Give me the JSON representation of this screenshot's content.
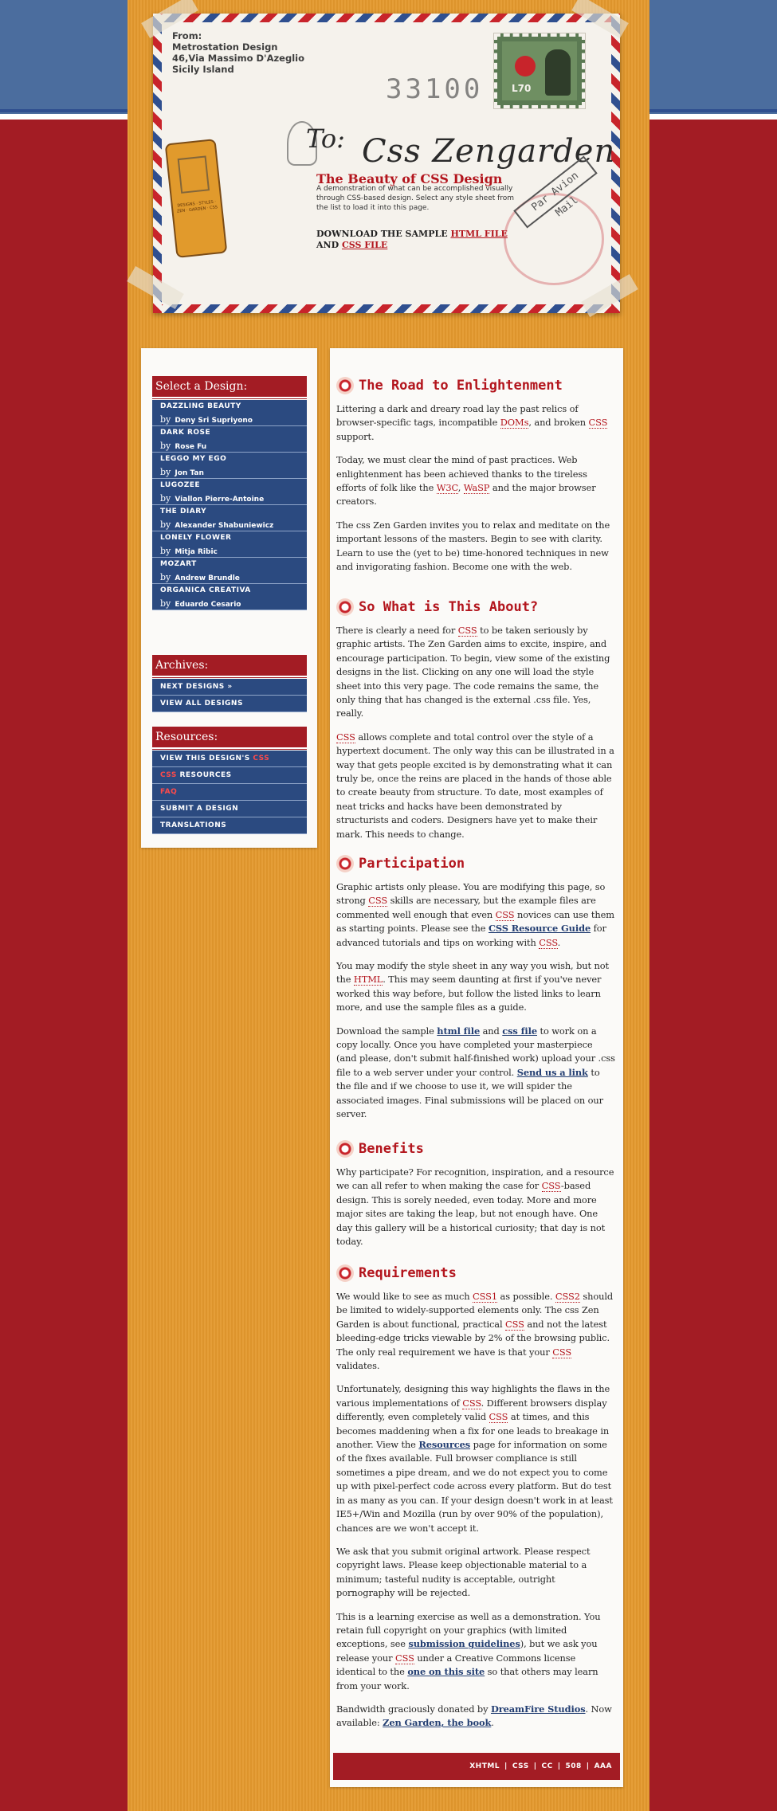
{
  "envelope": {
    "from_lines": [
      "From:",
      "Metrostation Design",
      "46,Via Massimo D'Azeglio",
      "Sicily Island"
    ],
    "postmark_number": "33100",
    "stamp_value": "L70",
    "to_label": "To:",
    "site_title": "Css Zengarden",
    "tagline": "The Beauty of CSS Design",
    "summary": "A demonstration of what can be accomplished visually through CSS-based design. Select any style sheet from the list to load it into this page.",
    "download_prefix": "DOWNLOAD THE SAMPLE",
    "download_html": "HTML FILE",
    "download_and": "AND",
    "download_css": "CSS FILE",
    "airmail": "Par Avion Mail"
  },
  "sidebar": {
    "select_heading": "Select a Design:",
    "by_label": "by",
    "designs": [
      {
        "name": "DAZZLING BEAUTY",
        "author": "Deny Sri Supriyono"
      },
      {
        "name": "DARK ROSE",
        "author": "Rose Fu"
      },
      {
        "name": "LEGGO MY EGO",
        "author": "Jon Tan"
      },
      {
        "name": "LUGOZEE",
        "author": "Viallon Pierre-Antoine"
      },
      {
        "name": "THE DIARY",
        "author": "Alexander Shabuniewicz"
      },
      {
        "name": "LONELY FLOWER",
        "author": "Mitja Ribic"
      },
      {
        "name": "MOZART",
        "author": "Andrew Brundle"
      },
      {
        "name": "ORGANICA CREATIVA",
        "author": "Eduardo Cesario"
      }
    ],
    "archives_heading": "Archives:",
    "archives": [
      "NEXT DESIGNS »",
      "VIEW ALL DESIGNS"
    ],
    "resources_heading": "Resources:",
    "resources": [
      {
        "pre": "VIEW THIS DESIGN'S ",
        "accent": "CSS",
        "post": ""
      },
      {
        "pre": "",
        "accent": "CSS",
        "post": " RESOURCES"
      },
      {
        "pre": "",
        "accent": "FAQ",
        "post": ""
      },
      {
        "pre": "SUBMIT A DESIGN",
        "accent": "",
        "post": ""
      },
      {
        "pre": "TRANSLATIONS",
        "accent": "",
        "post": ""
      }
    ]
  },
  "main": {
    "s1": {
      "title": "The Road to Enlightenment",
      "p1": [
        "Littering a dark and dreary road lay the past relics of browser-specific tags, incompatible ",
        "DOMs",
        ", and broken ",
        "CSS",
        " support."
      ],
      "p2": [
        "Today, we must clear the mind of past practices. Web enlightenment has been achieved thanks to the tireless efforts of folk like the ",
        "W3C",
        ", ",
        "WaSP",
        " and the major browser creators."
      ],
      "p3": "The css Zen Garden invites you to relax and meditate on the important lessons of the masters. Begin to see with clarity. Learn to use the (yet to be) time-honored techniques in new and invigorating fashion. Become one with the web."
    },
    "s2": {
      "title": "So What is This About?",
      "p1": [
        "There is clearly a need for ",
        "CSS",
        " to be taken seriously by graphic artists. The Zen Garden aims to excite, inspire, and encourage participation. To begin, view some of the existing designs in the list. Clicking on any one will load the style sheet into this very page. The code remains the same, the only thing that has changed is the external .css file. Yes, really."
      ],
      "p2": [
        "CSS",
        " allows complete and total control over the style of a hypertext document. The only way this can be illustrated in a way that gets people excited is by demonstrating what it can truly be, once the reins are placed in the hands of those able to create beauty from structure. To date, most examples of neat tricks and hacks have been demonstrated by structurists and coders. Designers have yet to make their mark. This needs to change."
      ]
    },
    "s3": {
      "title": "Participation",
      "p1": [
        "Graphic artists only please. You are modifying this page, so strong ",
        "CSS",
        " skills are necessary, but the example files are commented well enough that even ",
        "CSS",
        " novices can use them as starting points. Please see the ",
        "CSS Resource Guide",
        " for advanced tutorials and tips on working with ",
        "CSS",
        "."
      ],
      "p2": [
        "You may modify the style sheet in any way you wish, but not the ",
        "HTML",
        ". This may seem daunting at first if you've never worked this way before, but follow the listed links to learn more, and use the sample files as a guide."
      ],
      "p3": [
        "Download the sample ",
        "html file",
        " and ",
        "css file",
        " to work on a copy locally. Once you have completed your masterpiece (and please, don't submit half-finished work) upload your .css file to a web server under your control. ",
        "Send us a link",
        " to the file and if we choose to use it, we will spider the associated images. Final submissions will be placed on our server."
      ]
    },
    "s4": {
      "title": "Benefits",
      "p1": [
        "Why participate? For recognition, inspiration, and a resource we can all refer to when making the case for ",
        "CSS",
        "-based design. This is sorely needed, even today. More and more major sites are taking the leap, but not enough have. One day this gallery will be a historical curiosity; that day is not today."
      ]
    },
    "s5": {
      "title": "Requirements",
      "p1": [
        "We would like to see as much ",
        "CSS1",
        " as possible. ",
        "CSS2",
        " should be limited to widely-supported elements only. The css Zen Garden is about functional, practical ",
        "CSS",
        " and not the latest bleeding-edge tricks viewable by 2% of the browsing public. The only real requirement we have is that your ",
        "CSS",
        " validates."
      ],
      "p2": [
        "Unfortunately, designing this way highlights the flaws in the various implementations of ",
        "CSS",
        ". Different browsers display differently, even completely valid ",
        "CSS",
        " at times, and this becomes maddening when a fix for one leads to breakage in another. View the ",
        "Resources",
        " page for information on some of the fixes available. Full browser compliance is still sometimes a pipe dream, and we do not expect you to come up with pixel-perfect code across every platform. But do test in as many as you can. If your design doesn't work in at least IE5+/Win and Mozilla (run by over 90% of the population), chances are we won't accept it."
      ],
      "p3": "We ask that you submit original artwork. Please respect copyright laws. Please keep objectionable material to a minimum; tasteful nudity is acceptable, outright pornography will be rejected.",
      "p4": [
        "This is a learning exercise as well as a demonstration. You retain full copyright on your graphics (with limited exceptions, see ",
        "submission guidelines",
        "), but we ask you release your ",
        "CSS",
        " under a Creative Commons license identical to the ",
        "one on this site",
        " so that others may learn from your work."
      ],
      "p5": [
        "Bandwidth graciously donated by ",
        "DreamFire Studios",
        ". Now available: ",
        "Zen Garden, the book",
        "."
      ]
    },
    "footer_links": [
      "XHTML",
      "CSS",
      "CC",
      "508",
      "AAA"
    ]
  },
  "colors": {
    "page_red": "#a31c24",
    "top_blue": "#4b6d9e",
    "orange": "#e4992d",
    "link_red": "#b3151d",
    "nav_blue": "#2b4a80"
  }
}
